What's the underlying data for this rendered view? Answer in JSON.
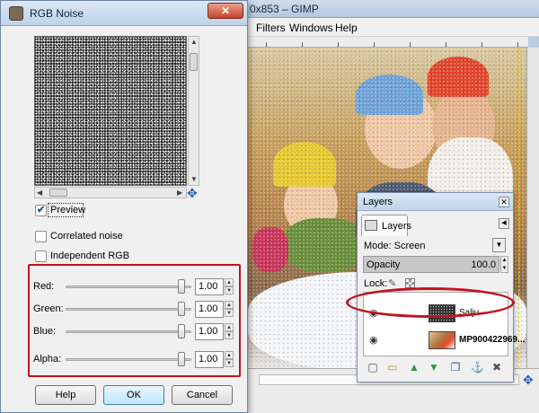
{
  "gimp": {
    "title": "0x853 – GIMP",
    "menus": [
      "Filters",
      "Windows",
      "Help"
    ]
  },
  "noise_dialog": {
    "title": "RGB Noise",
    "close_label": "✕",
    "preview_label": "Preview",
    "preview_checked": true,
    "correlated_label": "Correlated noise",
    "correlated_checked": false,
    "independent_label": "Independent RGB",
    "independent_checked": false,
    "sliders": [
      {
        "label": "Red:",
        "value": "1.00",
        "level": 0.95
      },
      {
        "label": "Green:",
        "value": "1.00",
        "level": 0.95
      },
      {
        "label": "Blue:",
        "value": "1.00",
        "level": 0.95
      },
      {
        "label": "Alpha:",
        "value": "1.00",
        "level": 0.95
      }
    ],
    "buttons": {
      "help": "Help",
      "ok": "OK",
      "cancel": "Cancel"
    }
  },
  "layers": {
    "title": "Layers",
    "close_label": "✕",
    "tab_label": "Layers",
    "mode_label": "Mode: Screen",
    "opacity_label": "Opacity",
    "opacity_value": "100.0",
    "lock_label": "Lock:",
    "items": [
      {
        "name": "Salju"
      },
      {
        "name": "MP900422969..."
      }
    ]
  },
  "colors": {
    "highlight": "#c1121f",
    "nav_icon": "#1f58c7"
  },
  "icons": [
    "gimp-icon",
    "navigate-icon",
    "eye-icon",
    "new-layer-icon",
    "folder-icon",
    "raise-layer-icon",
    "lower-layer-icon",
    "duplicate-icon",
    "anchor-icon",
    "delete-icon"
  ]
}
